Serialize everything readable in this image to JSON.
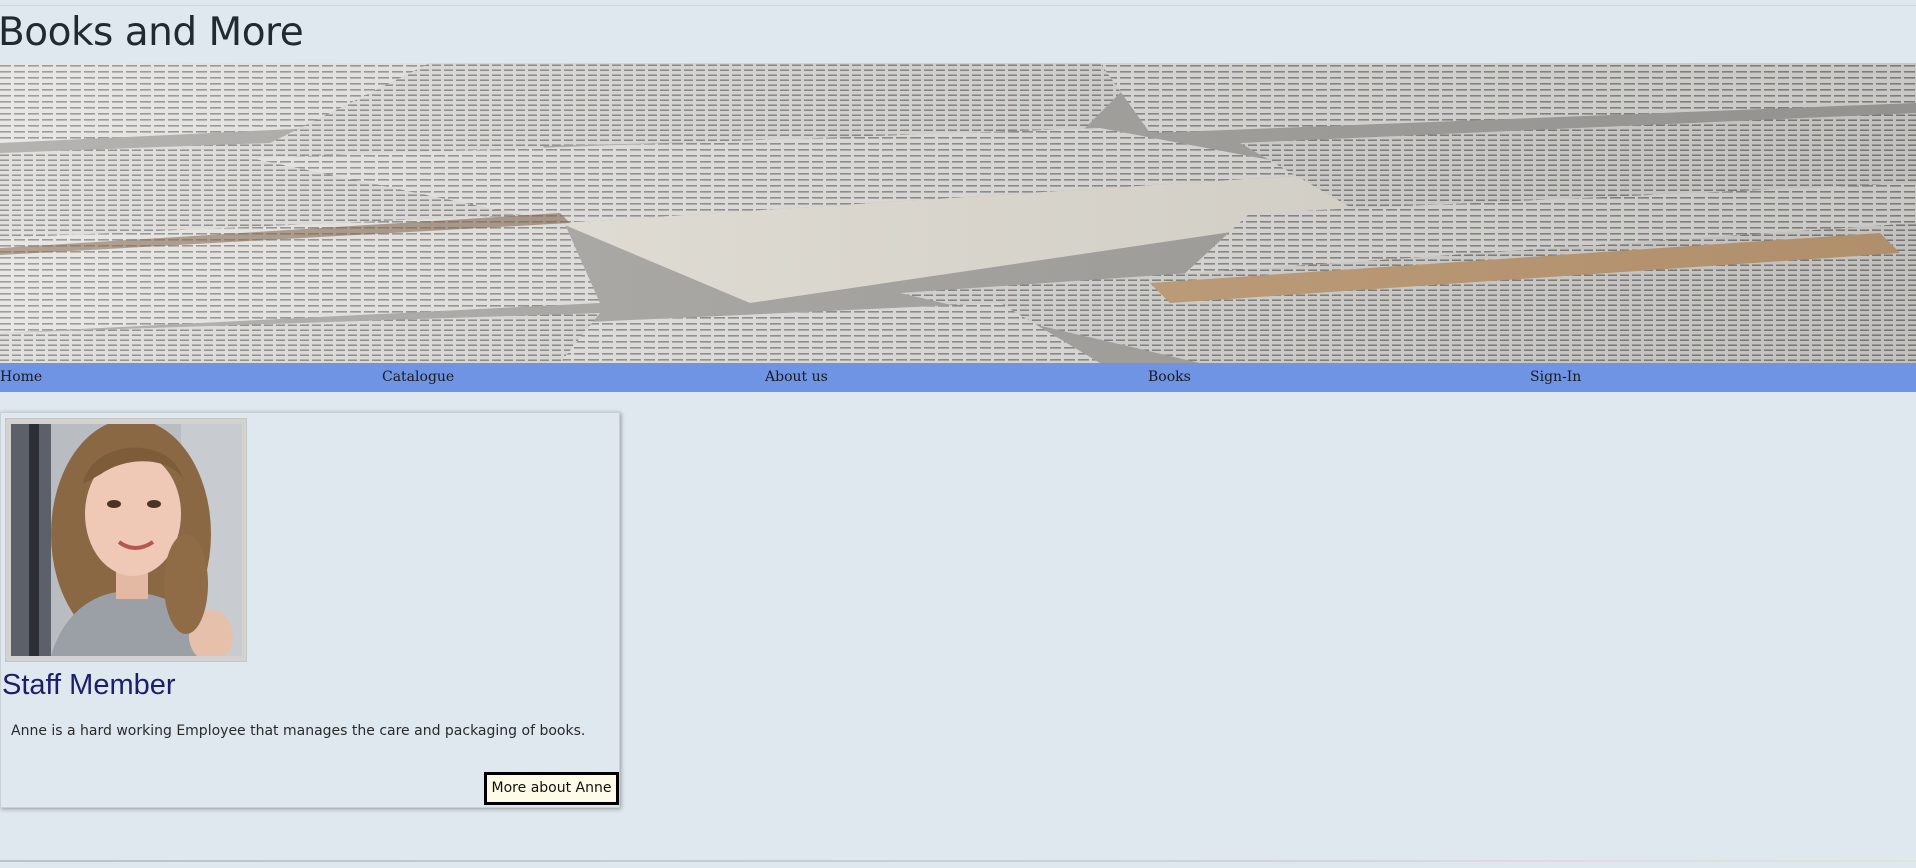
{
  "header": {
    "title": "Books and More"
  },
  "banner": {
    "icon": "open-books-photo"
  },
  "nav": {
    "items": [
      {
        "label": "Home"
      },
      {
        "label": "Catalogue"
      },
      {
        "label": "About us"
      },
      {
        "label": "Books"
      },
      {
        "label": "Sign-In"
      }
    ]
  },
  "staff_card": {
    "photo_icon": "staff-portrait-photo",
    "title": "Staff Member",
    "description": "Anne is a hard working Employee that manages the care and packaging of books.",
    "button_label": "More about Anne"
  },
  "colors": {
    "background": "#dfe8ef",
    "nav_bar": "#7094e4",
    "card_title": "#1b1e6b",
    "button_bg": "#fffbe9"
  }
}
